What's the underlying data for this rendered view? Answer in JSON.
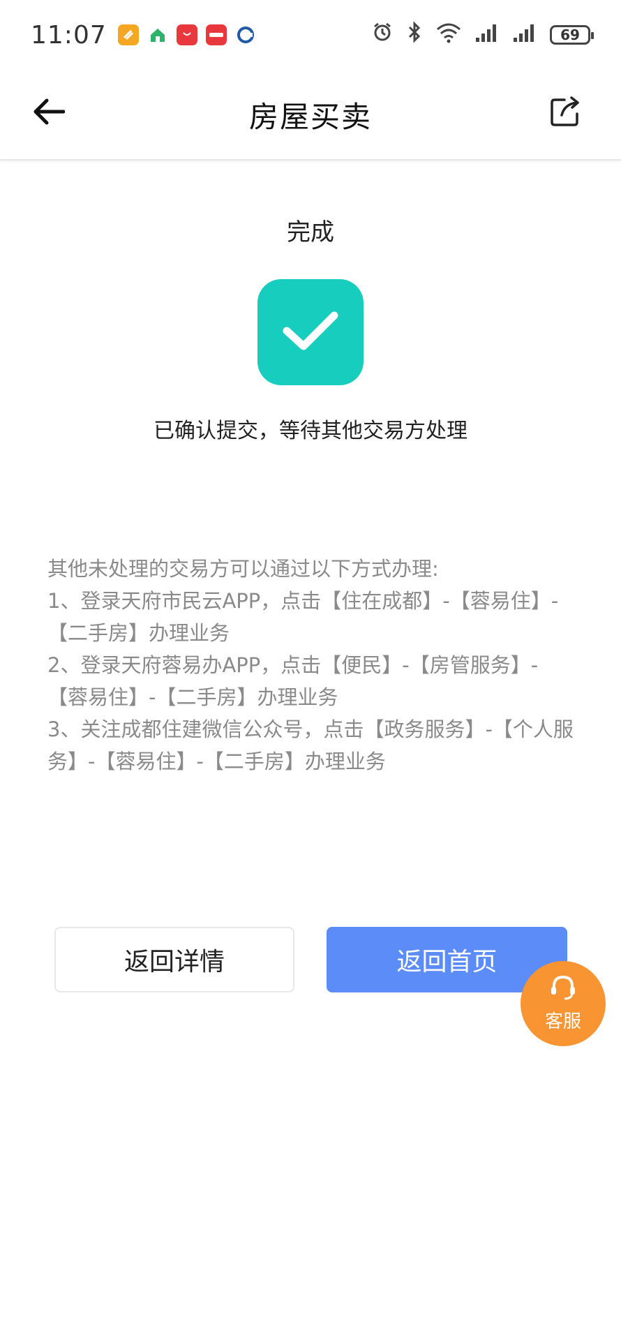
{
  "status_bar": {
    "time": "11:07",
    "battery": "69",
    "app_icons": [
      {
        "name": "app-icon-orange",
        "color": "#f5a623",
        "label": ""
      },
      {
        "name": "app-icon-house",
        "color": "#2fb36b",
        "label": ""
      },
      {
        "name": "app-icon-huawei",
        "color": "#e8383d",
        "label": "HUAWEI"
      },
      {
        "name": "app-icon-xiaohongshu",
        "color": "#e8383d",
        "label": "小红书"
      },
      {
        "name": "app-icon-ccb",
        "color": "#1f5aa6",
        "label": ""
      }
    ]
  },
  "nav": {
    "title": "房屋买卖",
    "back_icon": "arrow-left-icon",
    "share_icon": "share-icon"
  },
  "result": {
    "title": "完成",
    "message": "已确认提交，等待其他交易方处理",
    "accent": "#17cdbd"
  },
  "instructions": [
    "其他未处理的交易方可以通过以下方式办理:",
    "1、登录天府市民云APP，点击【住在成都】-【蓉易住】-【二手房】办理业务",
    "2、登录天府蓉易办APP，点击【便民】-【房管服务】-【蓉易住】-【二手房】办理业务",
    "3、关注成都住建微信公众号，点击【政务服务】-【个人服务】-【蓉易住】-【二手房】办理业务"
  ],
  "buttons": {
    "back_detail": "返回详情",
    "back_home": "返回首页",
    "primary_color": "#5b8cf8"
  },
  "service_fab": {
    "label": "客服",
    "color": "#f89431"
  }
}
